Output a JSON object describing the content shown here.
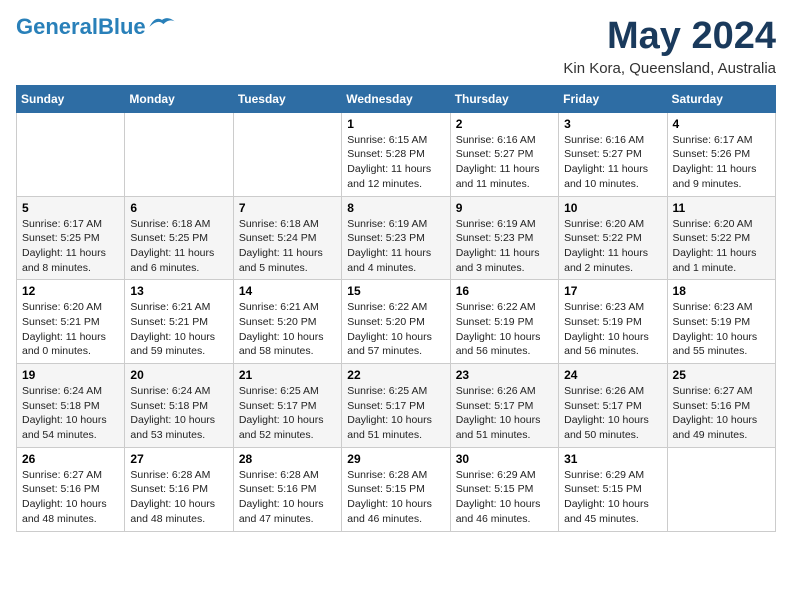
{
  "header": {
    "logo_line1": "General",
    "logo_line2": "Blue",
    "month_title": "May 2024",
    "location": "Kin Kora, Queensland, Australia"
  },
  "weekdays": [
    "Sunday",
    "Monday",
    "Tuesday",
    "Wednesday",
    "Thursday",
    "Friday",
    "Saturday"
  ],
  "weeks": [
    [
      {
        "day": "",
        "info": ""
      },
      {
        "day": "",
        "info": ""
      },
      {
        "day": "",
        "info": ""
      },
      {
        "day": "1",
        "info": "Sunrise: 6:15 AM\nSunset: 5:28 PM\nDaylight: 11 hours\nand 12 minutes."
      },
      {
        "day": "2",
        "info": "Sunrise: 6:16 AM\nSunset: 5:27 PM\nDaylight: 11 hours\nand 11 minutes."
      },
      {
        "day": "3",
        "info": "Sunrise: 6:16 AM\nSunset: 5:27 PM\nDaylight: 11 hours\nand 10 minutes."
      },
      {
        "day": "4",
        "info": "Sunrise: 6:17 AM\nSunset: 5:26 PM\nDaylight: 11 hours\nand 9 minutes."
      }
    ],
    [
      {
        "day": "5",
        "info": "Sunrise: 6:17 AM\nSunset: 5:25 PM\nDaylight: 11 hours\nand 8 minutes."
      },
      {
        "day": "6",
        "info": "Sunrise: 6:18 AM\nSunset: 5:25 PM\nDaylight: 11 hours\nand 6 minutes."
      },
      {
        "day": "7",
        "info": "Sunrise: 6:18 AM\nSunset: 5:24 PM\nDaylight: 11 hours\nand 5 minutes."
      },
      {
        "day": "8",
        "info": "Sunrise: 6:19 AM\nSunset: 5:23 PM\nDaylight: 11 hours\nand 4 minutes."
      },
      {
        "day": "9",
        "info": "Sunrise: 6:19 AM\nSunset: 5:23 PM\nDaylight: 11 hours\nand 3 minutes."
      },
      {
        "day": "10",
        "info": "Sunrise: 6:20 AM\nSunset: 5:22 PM\nDaylight: 11 hours\nand 2 minutes."
      },
      {
        "day": "11",
        "info": "Sunrise: 6:20 AM\nSunset: 5:22 PM\nDaylight: 11 hours\nand 1 minute."
      }
    ],
    [
      {
        "day": "12",
        "info": "Sunrise: 6:20 AM\nSunset: 5:21 PM\nDaylight: 11 hours\nand 0 minutes."
      },
      {
        "day": "13",
        "info": "Sunrise: 6:21 AM\nSunset: 5:21 PM\nDaylight: 10 hours\nand 59 minutes."
      },
      {
        "day": "14",
        "info": "Sunrise: 6:21 AM\nSunset: 5:20 PM\nDaylight: 10 hours\nand 58 minutes."
      },
      {
        "day": "15",
        "info": "Sunrise: 6:22 AM\nSunset: 5:20 PM\nDaylight: 10 hours\nand 57 minutes."
      },
      {
        "day": "16",
        "info": "Sunrise: 6:22 AM\nSunset: 5:19 PM\nDaylight: 10 hours\nand 56 minutes."
      },
      {
        "day": "17",
        "info": "Sunrise: 6:23 AM\nSunset: 5:19 PM\nDaylight: 10 hours\nand 56 minutes."
      },
      {
        "day": "18",
        "info": "Sunrise: 6:23 AM\nSunset: 5:19 PM\nDaylight: 10 hours\nand 55 minutes."
      }
    ],
    [
      {
        "day": "19",
        "info": "Sunrise: 6:24 AM\nSunset: 5:18 PM\nDaylight: 10 hours\nand 54 minutes."
      },
      {
        "day": "20",
        "info": "Sunrise: 6:24 AM\nSunset: 5:18 PM\nDaylight: 10 hours\nand 53 minutes."
      },
      {
        "day": "21",
        "info": "Sunrise: 6:25 AM\nSunset: 5:17 PM\nDaylight: 10 hours\nand 52 minutes."
      },
      {
        "day": "22",
        "info": "Sunrise: 6:25 AM\nSunset: 5:17 PM\nDaylight: 10 hours\nand 51 minutes."
      },
      {
        "day": "23",
        "info": "Sunrise: 6:26 AM\nSunset: 5:17 PM\nDaylight: 10 hours\nand 51 minutes."
      },
      {
        "day": "24",
        "info": "Sunrise: 6:26 AM\nSunset: 5:17 PM\nDaylight: 10 hours\nand 50 minutes."
      },
      {
        "day": "25",
        "info": "Sunrise: 6:27 AM\nSunset: 5:16 PM\nDaylight: 10 hours\nand 49 minutes."
      }
    ],
    [
      {
        "day": "26",
        "info": "Sunrise: 6:27 AM\nSunset: 5:16 PM\nDaylight: 10 hours\nand 48 minutes."
      },
      {
        "day": "27",
        "info": "Sunrise: 6:28 AM\nSunset: 5:16 PM\nDaylight: 10 hours\nand 48 minutes."
      },
      {
        "day": "28",
        "info": "Sunrise: 6:28 AM\nSunset: 5:16 PM\nDaylight: 10 hours\nand 47 minutes."
      },
      {
        "day": "29",
        "info": "Sunrise: 6:28 AM\nSunset: 5:15 PM\nDaylight: 10 hours\nand 46 minutes."
      },
      {
        "day": "30",
        "info": "Sunrise: 6:29 AM\nSunset: 5:15 PM\nDaylight: 10 hours\nand 46 minutes."
      },
      {
        "day": "31",
        "info": "Sunrise: 6:29 AM\nSunset: 5:15 PM\nDaylight: 10 hours\nand 45 minutes."
      },
      {
        "day": "",
        "info": ""
      }
    ]
  ]
}
